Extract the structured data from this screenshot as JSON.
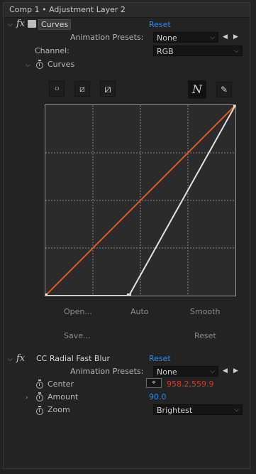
{
  "panel": {
    "title": "Comp 1 • Adjustment Layer 2"
  },
  "curves_effect": {
    "name": "Curves",
    "reset": "Reset",
    "presets_label": "Animation Presets:",
    "presets_value": "None",
    "channel_label": "Channel:",
    "channel_value": "RGB",
    "curves_label": "Curves",
    "buttons": {
      "open": "Open...",
      "auto": "Auto",
      "smooth": "Smooth",
      "save": "Save...",
      "reset": "Reset"
    }
  },
  "blur_effect": {
    "name": "CC Radial Fast Blur",
    "reset": "Reset",
    "presets_label": "Animation Presets:",
    "presets_value": "None",
    "center_label": "Center",
    "center_value": "958.2,559.9",
    "amount_label": "Amount",
    "amount_value": "90.0",
    "zoom_label": "Zoom",
    "zoom_value": "Brightest"
  },
  "curve_points": {
    "rgb_line": [
      [
        0,
        0
      ],
      [
        1,
        1
      ]
    ],
    "white_curve": [
      [
        0,
        0
      ],
      [
        0.44,
        0
      ],
      [
        1,
        1
      ]
    ]
  },
  "colors": {
    "accent_blue": "#2d8ceb",
    "red_value": "#d83a2e",
    "orange_curve": "#d4612c"
  }
}
